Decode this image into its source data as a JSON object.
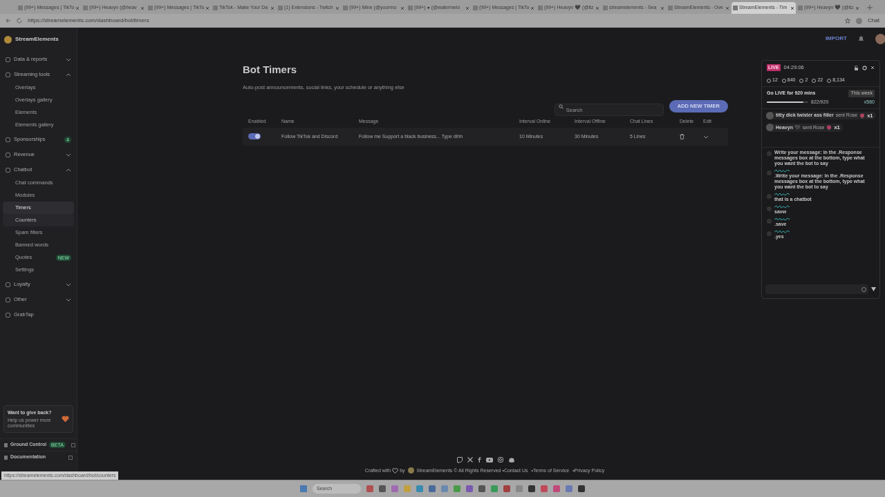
{
  "browser": {
    "tabs": [
      {
        "title": "(99+) Messages | TikTo",
        "selected": false
      },
      {
        "title": "(99+) Heavyn (@heav",
        "selected": false
      },
      {
        "title": "(99+) Messages | TikTo",
        "selected": false
      },
      {
        "title": "TikTok - Make Your Da",
        "selected": false
      },
      {
        "title": "(1) Extensions - Twitch",
        "selected": false
      },
      {
        "title": "(99+) Mine (@yourmo",
        "selected": false
      },
      {
        "title": "(99+) ● (@watermelo",
        "selected": false
      },
      {
        "title": "(99+) Messages | TikTo",
        "selected": false
      },
      {
        "title": "(99+) Heavyn 🖤 (@itz",
        "selected": false
      },
      {
        "title": "streamelements - Sea",
        "selected": false
      },
      {
        "title": "StreamElements - Ove",
        "selected": false
      },
      {
        "title": "StreamElements - Tim",
        "selected": true
      },
      {
        "title": "(99+) Heavyn 🖤 (@itz",
        "selected": false
      }
    ],
    "url": "https://streamelements.com/dashboard/bot/timers",
    "copilot": "Chat"
  },
  "sidebar": {
    "brand": "StreamElements",
    "items": [
      {
        "kind": "section",
        "label": "Data & reports",
        "expanded": false
      },
      {
        "kind": "section",
        "label": "Streaming tools",
        "expanded": true,
        "children": [
          {
            "label": "Overlays",
            "selected": false
          },
          {
            "label": "Overlays gallery",
            "selected": false
          },
          {
            "label": "Elements",
            "selected": false
          },
          {
            "label": "Elements gallery",
            "selected": false
          }
        ]
      },
      {
        "kind": "section",
        "label": "Sponsorships",
        "badge": "4"
      },
      {
        "kind": "section",
        "label": "Revenue",
        "expanded": false
      },
      {
        "kind": "section",
        "label": "Chatbot",
        "expanded": true,
        "children": [
          {
            "label": "Chat commands",
            "selected": false
          },
          {
            "label": "Modules",
            "selected": false
          },
          {
            "label": "Timers",
            "selected": true
          },
          {
            "label": "Counters",
            "selected": false,
            "hovered": true
          },
          {
            "label": "Spam filters",
            "selected": false
          },
          {
            "label": "Banned words",
            "selected": false
          },
          {
            "label": "Quotes",
            "selected": false,
            "badge": "NEW"
          },
          {
            "label": "Settings",
            "selected": false
          }
        ]
      },
      {
        "kind": "section",
        "label": "Loyalty",
        "expanded": false
      },
      {
        "kind": "section",
        "label": "Other",
        "expanded": false
      },
      {
        "kind": "section",
        "label": "GrabTap"
      }
    ],
    "give_back": {
      "title": "Want to give back?",
      "text": "Help us power more communities"
    },
    "footer_links": [
      {
        "label": "Ground Control",
        "badge": "BETA"
      },
      {
        "label": "Documentation"
      }
    ]
  },
  "header": {
    "import": "IMPORT"
  },
  "page": {
    "title": "Bot Timers",
    "subtitle": "Auto-post announcements, social links, your schedule or anything else",
    "search": {
      "placeholder": "Search"
    },
    "add_button": "ADD NEW TIMER",
    "table": {
      "columns": [
        "Enabled",
        "Name",
        "Message",
        "Interval Online",
        "Interval Offline",
        "Chat Lines",
        "Delete",
        "Edit"
      ],
      "rows": [
        {
          "enabled": true,
          "name": "Follow TikTok and Discord",
          "message": "Follow me Support a black business... Type dihh",
          "interval_online": "10 Minutes",
          "interval_offline": "30 Minutes",
          "chat_lines": "5 Lines"
        }
      ]
    }
  },
  "footer": {
    "crafted": "Crafted with",
    "by": "by",
    "brand": "StreamElements © All Rights Reserved",
    "links": [
      "•Contact Us",
      "•Terms of Service",
      "•Privacy Policy"
    ]
  },
  "chat_panel": {
    "live": "LIVE",
    "timer": "04:29:06",
    "stats": [
      "12",
      "840",
      "2",
      "22",
      "8,134"
    ],
    "goal": {
      "title": "Go LIVE for 920 mins",
      "period": "This week",
      "progress": "822/920",
      "level": 0.89,
      "reward": "x560"
    },
    "gifts": [
      {
        "user": "titty dick twister ass filler",
        "action": "sent Rose",
        "count": "x1"
      },
      {
        "user": "Heavyn 🖤",
        "action": "sent Rose",
        "count": "x1"
      }
    ],
    "messages": [
      "Write your message: In the .Response messages box at the bottom, type what you want the bot to say",
      ".Write your message: In the .Response messages box at the bottom, type what you want the bot to say",
      "that is a chatbot",
      "savw",
      ".save",
      ".yes"
    ]
  },
  "status_url": "https://streamelements.com/dashboard/bot/counters",
  "taskbar": {
    "search": "Search"
  }
}
